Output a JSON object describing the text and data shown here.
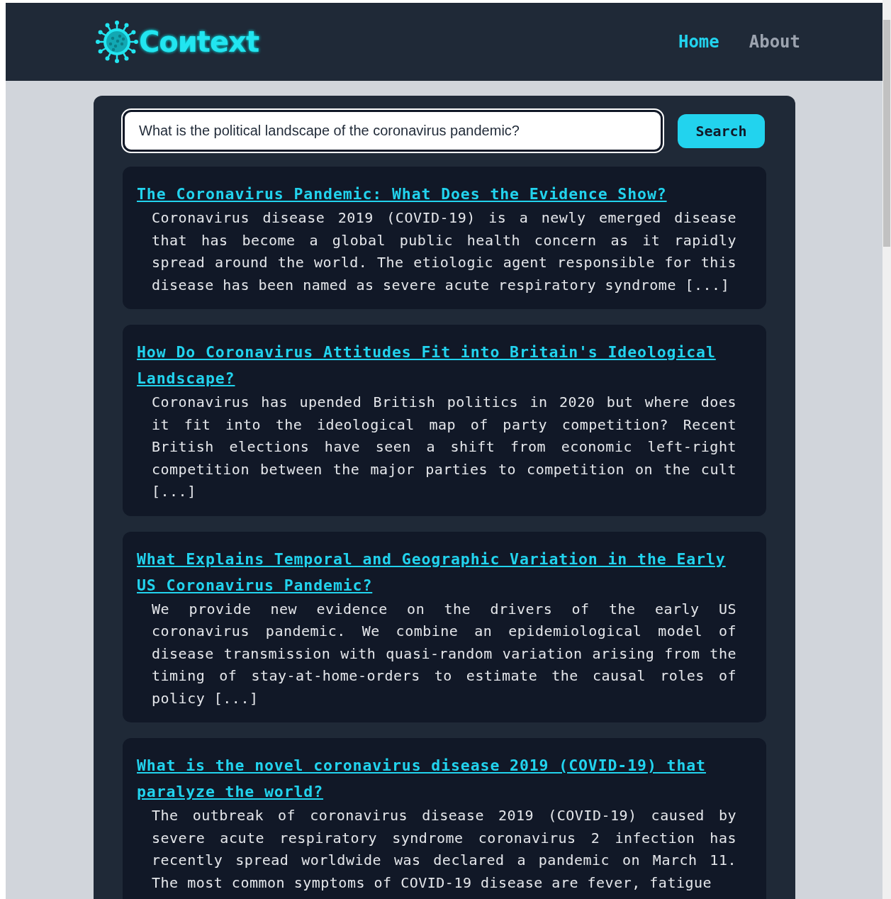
{
  "header": {
    "logo_text": "Coиtext",
    "nav": [
      {
        "label": "Home",
        "selected": true
      },
      {
        "label": "About",
        "selected": false
      }
    ]
  },
  "search": {
    "value": "What is the political landscape of the coronavirus pandemic?",
    "button": "Search"
  },
  "results": [
    {
      "title": "The Coronavirus Pandemic: What Does the Evidence Show?",
      "snippet": "Coronavirus disease 2019 (COVID-19) is a newly emerged disease that has become a global public health concern as it rapidly spread around the world. The etiologic agent responsible for this disease has been named as severe acute respiratory syndrome [...]"
    },
    {
      "title": "How Do Coronavirus Attitudes Fit into Britain's Ideological Landscape?",
      "snippet": "Coronavirus has upended British politics in 2020 but where does it fit into the ideological map of party competition? Recent British elections have seen a shift from economic left-right competition between the major parties to competition on the cult [...]"
    },
    {
      "title": "What Explains Temporal and Geographic Variation in the Early US Coronavirus Pandemic?",
      "snippet": "We provide new evidence on the drivers of the early US coronavirus pandemic. We combine an epidemiological model of disease transmission with quasi-random variation arising from the timing of stay-at-home-orders to estimate the causal roles of policy [...]"
    },
    {
      "title": "What is the novel coronavirus disease 2019 (COVID-19) that paralyze the world?",
      "snippet": "The outbreak of coronavirus disease 2019 (COVID-19) caused by severe acute respiratory syndrome coronavirus 2 infection has recently spread worldwide was declared a pandemic on March 11. The most common symptoms of COVID-19 disease are fever, fatigue"
    }
  ]
}
